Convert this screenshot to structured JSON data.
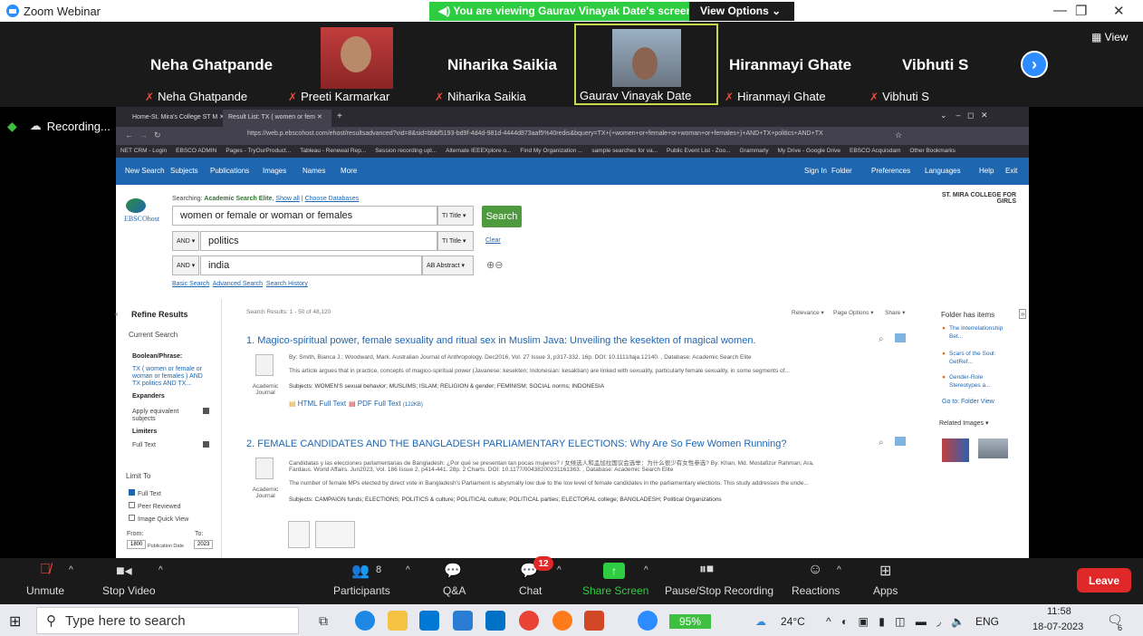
{
  "app": {
    "title": "Zoom Webinar"
  },
  "share_bar": {
    "viewing": "You are viewing Gaurav Vinayak Date's screen",
    "view_options": "View Options"
  },
  "gallery": {
    "view_label": "View",
    "tiles": [
      {
        "big": "Neha Ghatpande",
        "small": "Neha Ghatpande"
      },
      {
        "big": "",
        "small": "Preeti Karmarkar"
      },
      {
        "big": "Niharika Saikia",
        "small": "Niharika Saikia"
      },
      {
        "big": "",
        "small": "Gaurav Vinayak Date"
      },
      {
        "big": "Hiranmayi Ghate",
        "small": "Hiranmayi Ghate"
      },
      {
        "big": "Vibhuti S",
        "small": "Vibhuti S"
      }
    ]
  },
  "recording": {
    "label": "Recording..."
  },
  "browser": {
    "tabs": [
      "Home-St. Mira's College ST M",
      "Result List: TX ( women or fem"
    ],
    "url": "https://web.p.ebscohost.com/ehost/resultsadvanced?vid=8&sid=bbbf5193-bd9f-4d4d-981d-4444d873aaf5%40redis&bquery=TX+(+women+or+female+or+woman+or+females+)+AND+TX+politics+AND+TX",
    "bookmarks": [
      "NET CRM - Login",
      "EBSCO ADMIN",
      "Pages - TryOurProduct...",
      "Tableau - Renewal Rep...",
      "Session recording upl...",
      "Alternate IEEEXplore o...",
      "Find My Organization ...",
      "sample searches for va...",
      "Public Event List - Zoo...",
      "Grammarly",
      "My Drive - Google Drive",
      "EBSCO Acquisdam",
      "Other Bookmarks"
    ]
  },
  "ebsco": {
    "nav": [
      "New Search",
      "Subjects",
      "Publications",
      "Images",
      "Names",
      "More"
    ],
    "nav_right": [
      "Sign In",
      "Folder",
      "Preferences",
      "Languages",
      "Help",
      "Exit"
    ],
    "logo": "EBSCOhost",
    "searching_prefix": "Searching:",
    "database": "Academic Search Elite",
    "show_all": "Show all",
    "choose_db": "Choose Databases",
    "institution": "ST. MIRA COLLEGE FOR GIRLS",
    "rows": [
      {
        "bool": "",
        "term": "women or female or woman or females",
        "field": "TI Title"
      },
      {
        "bool": "AND",
        "term": "politics",
        "field": "TI Title"
      },
      {
        "bool": "AND",
        "term": "india",
        "field": "AB Abstract"
      }
    ],
    "search_button": "Search",
    "clear": "Clear",
    "links": [
      "Basic Search",
      "Advanced Search",
      "Search History"
    ]
  },
  "refine": {
    "title": "Refine Results",
    "current": "Current Search",
    "boolean_label": "Boolean/Phrase:",
    "boolean_lines": [
      "TX ( women or female or",
      "woman or females ) AND",
      "TX politics AND TX..."
    ],
    "expanders": "Expanders",
    "expander_item_lines": [
      "Apply equivalent",
      "subjects"
    ],
    "limiters": "Limiters",
    "limiter_item": "Full Text",
    "limit_to": "Limit To",
    "checks": [
      {
        "label": "Full Text",
        "checked": true
      },
      {
        "label": "Peer Reviewed",
        "checked": false
      },
      {
        "label": "Image Quick View",
        "checked": false
      }
    ],
    "from_label": "From:",
    "to_label": "To:",
    "from_year": "1800",
    "pub_date_label": "Publication Date",
    "to_year": "2023"
  },
  "results": {
    "count": "Search Results: 1 - 50 of 48,120",
    "sort": "Relevance",
    "page_options": "Page Options",
    "share": "Share",
    "items": [
      {
        "num": "1.",
        "title": "Magico-spiritual power, female sexuality and ritual sex in Muslim Java: Unveiling the kesekten of magical women.",
        "meta": "By: Smith, Bianca J.; Woodward, Mark. Australian Journal of Anthropology. Dec2016, Vol. 27 Issue 3, p317-332. 16p. DOI: 10.1111/taja.12140. , Database: Academic Search Elite",
        "abstract": "This article argues that in practice, concepts of magico-spiritual power (Javanese: kesekten; Indonesian: kesaktian) are linked with sexuality, particularly female sexuality, in some segments of...",
        "subjects": "Subjects: WOMEN'S sexual behavior; MUSLIMS; ISLAM; RELIGION & gender; FEMINISM; SOCIAL norms; INDONESIA",
        "type": "Academic Journal",
        "html_link": "HTML Full Text",
        "pdf_link": "PDF Full Text",
        "pdf_size": "(122KB)"
      },
      {
        "num": "2.",
        "title": "FEMALE CANDIDATES AND THE BANGLADESH PARLIAMENTARY ELECTIONS: Why Are So Few Women Running?",
        "meta1": "Candidatas y las elecciones parlamentarias de Bangladesh: ¿Por qué se presentan tan pocas mujeres? / 女候选人和孟加拉国议会选举：为什么很少有女性参选? By: Khan, Md. Mostafizur Rahman; Ara,",
        "meta2": "Fardaus. World Affairs. Jun2023, Vol. 186 Issue 2, p414-441. 28p. 2 Charts. DOI: 10.1177/00438200231161363. , Database: Academic Search Elite",
        "abstract": "The number of female MPs elected by direct vote in Bangladesh's Parliament is abysmally low due to the low level of female candidates in the parliamentary elections. This study addresses the unde...",
        "subjects": "Subjects: CAMPAIGN funds; ELECTIONS; POLITICS & culture; POLITICAL culture; POLITICAL parties; ELECTORAL college; BANGLADESH; Political Organizations",
        "type": "Academic Journal"
      }
    ]
  },
  "folder": {
    "title": "Folder has items",
    "items": [
      [
        "The Interrelationship",
        "Bet..."
      ],
      [
        "Scars of the Soul:",
        "GetRef..."
      ],
      [
        "Gender-Role",
        "Stereotypes a..."
      ]
    ],
    "go_to": "Go to: Folder View",
    "related_images": "Related Images"
  },
  "toolbar": {
    "unmute": "Unmute",
    "stop_video": "Stop Video",
    "participants": "Participants",
    "participants_count": "8",
    "qa": "Q&A",
    "chat": "Chat",
    "chat_badge": "12",
    "share_screen": "Share Screen",
    "pause_recording": "Pause/Stop Recording",
    "reactions": "Reactions",
    "apps": "Apps",
    "leave": "Leave"
  },
  "taskbar": {
    "search_placeholder": "Type here to search",
    "battery": "95%",
    "temperature": "24°C",
    "lang": "ENG",
    "time": "11:58",
    "date": "18-07-2023",
    "notifications": "6"
  },
  "colors": {
    "zoom_blue": "#2d8cff",
    "share_green": "#2ecc40",
    "ebsco_blue": "#1f66b0",
    "leave_red": "#e02828"
  }
}
